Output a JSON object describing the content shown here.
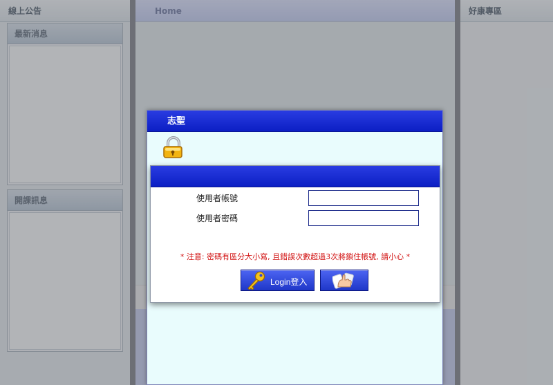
{
  "left_column": {
    "header": "線上公告"
  },
  "news_panel": {
    "title": "最新消息"
  },
  "course_panel": {
    "title": "開課訊息"
  },
  "main": {
    "header": "Home"
  },
  "right_column": {
    "header": "好康專區"
  },
  "dialog": {
    "title": "志聖",
    "username_label": "使用者帳號",
    "username_value": "",
    "password_label": "使用者密碼",
    "password_value": "",
    "notice": "* 注意: 密碼有區分大小寫, 且錯誤次數超過3次將鎖住帳號, 請小心 *",
    "login_button_label": "Login登入"
  },
  "icons": {
    "lock": "padlock-icon",
    "key": "key-icon",
    "other_button": "hand-pointer-icon"
  }
}
